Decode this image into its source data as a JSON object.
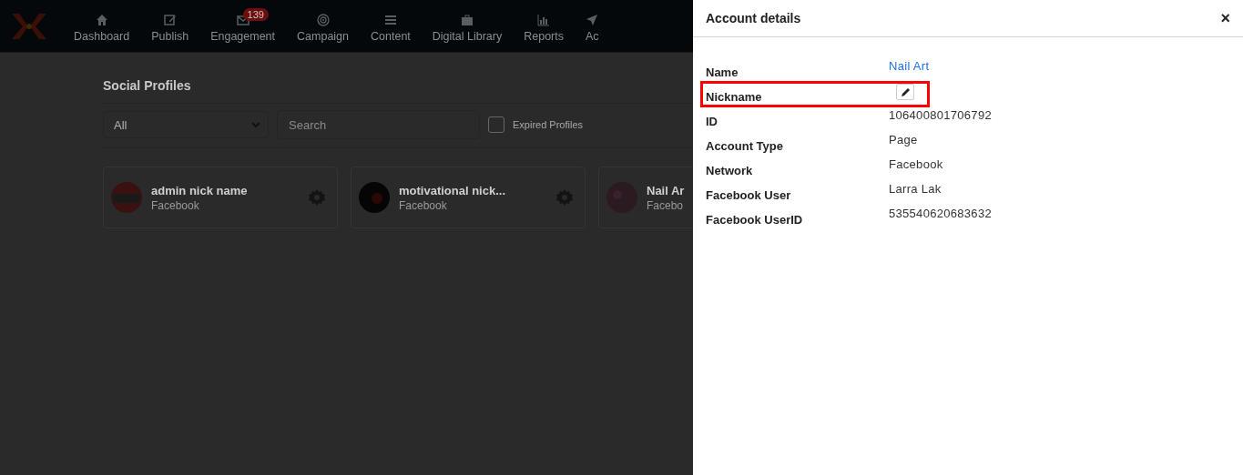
{
  "nav": {
    "items": [
      {
        "kind": "home",
        "label": "Dashboard"
      },
      {
        "kind": "edit",
        "label": "Publish"
      },
      {
        "kind": "mail",
        "label": "Engagement",
        "badge": "139"
      },
      {
        "kind": "target",
        "label": "Campaign"
      },
      {
        "kind": "list",
        "label": "Content"
      },
      {
        "kind": "briefcase",
        "label": "Digital Library"
      },
      {
        "kind": "chart",
        "label": "Reports"
      },
      {
        "kind": "send",
        "label": "Ac"
      }
    ]
  },
  "page": {
    "title": "Social Profiles",
    "filter": {
      "value": "All"
    },
    "search": {
      "placeholder": "Search"
    },
    "expired": {
      "label": "Expired Profiles",
      "checked": false
    },
    "profiles": [
      {
        "name": "admin nick name",
        "network": "Facebook",
        "kind": "admin",
        "settings": true
      },
      {
        "name": "motivational nick...",
        "network": "Facebook",
        "kind": "dark",
        "settings": true
      },
      {
        "name": "Nail Ar",
        "network": "Facebo",
        "kind": "nails"
      }
    ]
  },
  "panel": {
    "title": "Account details",
    "close": "×",
    "rows": [
      {
        "kind": "link",
        "label": "Name",
        "value": "Nail Art",
        "highlighted": false
      },
      {
        "kind": "edit",
        "label": "Nickname",
        "highlighted": true
      },
      {
        "kind": "text",
        "label": "ID",
        "value": "106400801706792",
        "highlighted": false
      },
      {
        "kind": "text",
        "label": "Account Type",
        "value": "Page",
        "highlighted": false
      },
      {
        "kind": "text",
        "label": "Network",
        "value": "Facebook",
        "highlighted": false
      },
      {
        "kind": "text",
        "label": "Facebook User",
        "value": "Larra Lak",
        "highlighted": false
      },
      {
        "kind": "text",
        "label": "Facebook UserID",
        "value": "535540620683632",
        "highlighted": false
      }
    ]
  }
}
